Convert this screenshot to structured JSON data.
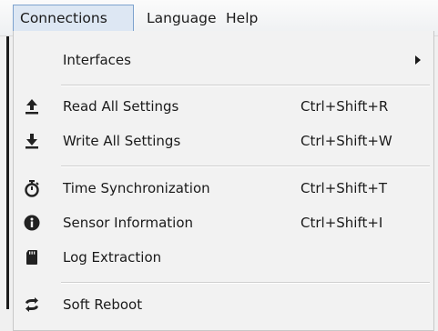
{
  "menubar": {
    "connections": "Connections",
    "language": "Language",
    "help": "Help"
  },
  "menu": {
    "interfaces": {
      "label": "Interfaces"
    },
    "read_all": {
      "label": "Read All Settings",
      "shortcut": "Ctrl+Shift+R",
      "icon": "upload-icon"
    },
    "write_all": {
      "label": "Write All Settings",
      "shortcut": "Ctrl+Shift+W",
      "icon": "download-icon"
    },
    "time_sync": {
      "label": "Time Synchronization",
      "shortcut": "Ctrl+Shift+T",
      "icon": "stopwatch-icon"
    },
    "sensor_info": {
      "label": "Sensor Information",
      "shortcut": "Ctrl+Shift+I",
      "icon": "info-icon"
    },
    "log_extract": {
      "label": "Log Extraction",
      "icon": "sd-card-icon"
    },
    "soft_reboot": {
      "label": "Soft Reboot",
      "icon": "refresh-icon"
    }
  }
}
